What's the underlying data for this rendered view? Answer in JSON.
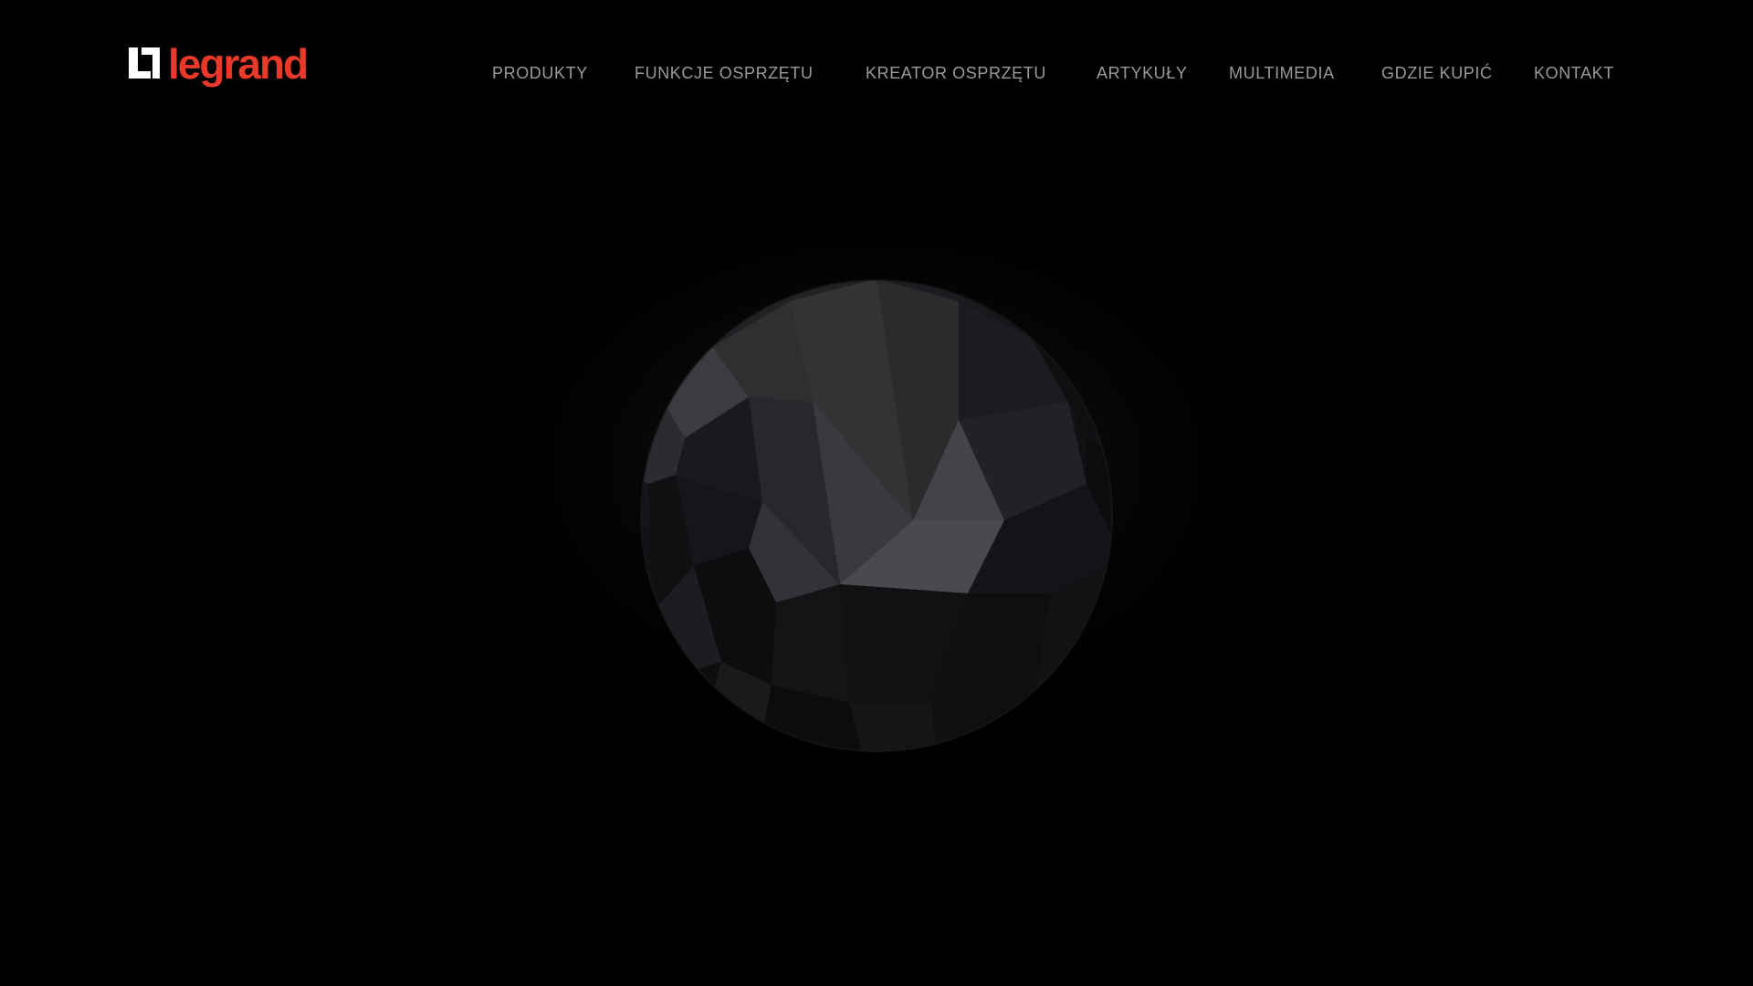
{
  "brand": {
    "wordmark": "legrand",
    "accent_color": "#e8392b",
    "mark_color": "#ffffff"
  },
  "nav": {
    "items": [
      {
        "label": "PRODUKTY"
      },
      {
        "label": "FUNKCJE OSPRZĘTU"
      },
      {
        "label": "KREATOR OSPRZĘTU"
      },
      {
        "label": "ARTYKUŁY"
      },
      {
        "label": "MULTIMEDIA"
      },
      {
        "label": "GDZIE KUPIĆ"
      },
      {
        "label": "KONTAKT"
      }
    ],
    "text_color": "#9a9a9a"
  },
  "hero": {
    "background": "#000000",
    "visual": "faceted-dark-sphere"
  }
}
